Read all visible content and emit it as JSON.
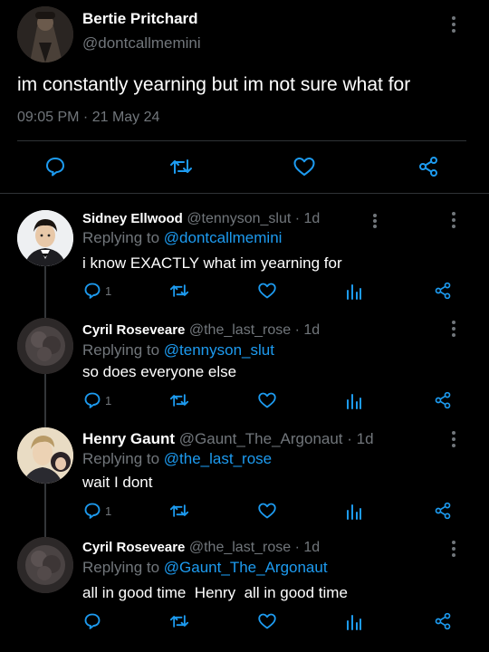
{
  "post": {
    "author_name": "Bertie Pritchard",
    "author_handle": "@dontcallmemini",
    "text": "im constantly yearning but im not sure what for",
    "timestamp": "09:05 PM · 21 May 24"
  },
  "replies": [
    {
      "name": "Sidney Ellwood",
      "handle": "@tennyson_slut",
      "time": "· 1d",
      "replying_label": "Replying to",
      "replying_to": "@dontcallmemini",
      "text": "i know EXACTLY what im yearning for",
      "reply_count": "1"
    },
    {
      "name": "Cyril Roseveare",
      "handle": "@the_last_rose",
      "time": "· 1d",
      "replying_label": "Replying to",
      "replying_to": "@tennyson_slut",
      "text": "so does everyone else",
      "reply_count": "1"
    },
    {
      "name": "Henry Gaunt",
      "handle": "@Gaunt_The_Argonaut",
      "time": "· 1d",
      "replying_label": "Replying to",
      "replying_to": "@the_last_rose",
      "text": "wait I dont",
      "reply_count": "1"
    },
    {
      "name": "Cyril Roseveare",
      "handle": "@the_last_rose",
      "time": "· 1d",
      "replying_label": "Replying to",
      "replying_to": "@Gaunt_The_Argonaut",
      "text": "all in good time  Henry  all in good time",
      "reply_count": ""
    }
  ],
  "colors": {
    "background": "#000000",
    "text": "#e7e9ea",
    "secondary": "#71767b",
    "link": "#1d9bf0",
    "divider": "#2f3336"
  }
}
